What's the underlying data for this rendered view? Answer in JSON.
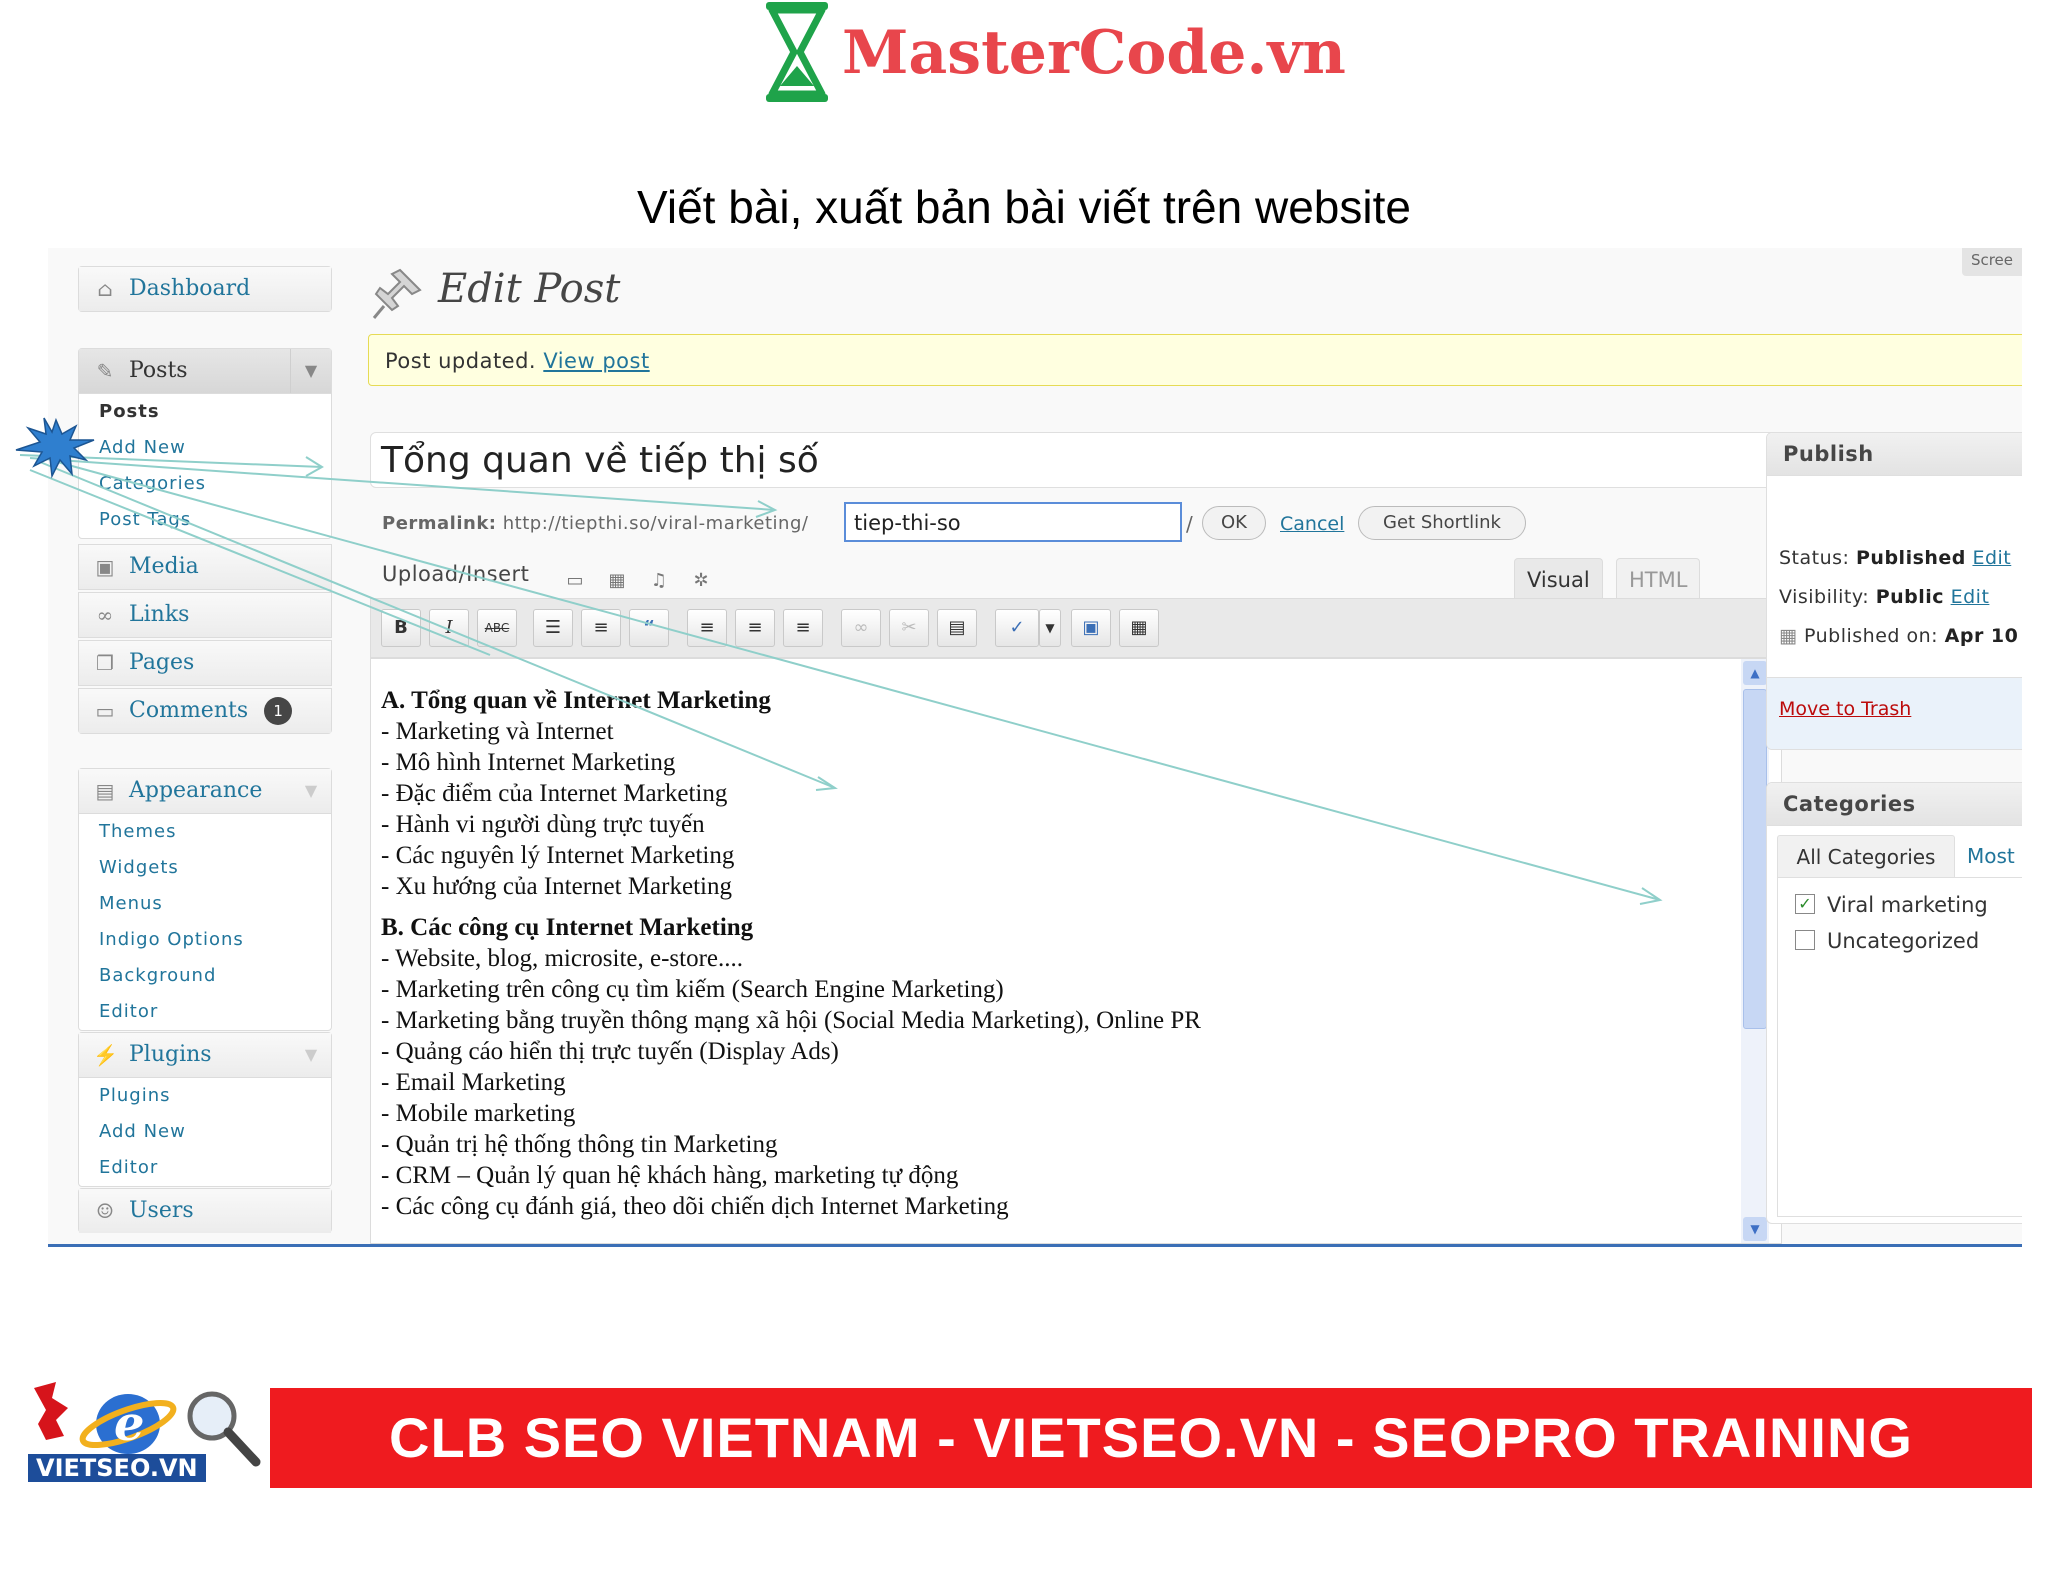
{
  "header": {
    "brand": "MasterCode.vn",
    "slide_title": "Viết bài, xuất bản bài viết trên website"
  },
  "sidebar": {
    "dashboard": "Dashboard",
    "posts": {
      "label": "Posts",
      "items": [
        "Posts",
        "Add New",
        "Categories",
        "Post Tags"
      ]
    },
    "media": "Media",
    "links": "Links",
    "pages": "Pages",
    "comments": {
      "label": "Comments",
      "count": "1"
    },
    "appearance": {
      "label": "Appearance",
      "items": [
        "Themes",
        "Widgets",
        "Menus",
        "Indigo Options",
        "Background",
        "Editor"
      ]
    },
    "plugins": {
      "label": "Plugins",
      "items": [
        "Plugins",
        "Add New",
        "Editor"
      ]
    },
    "users": "Users"
  },
  "main": {
    "page_title": "Edit Post",
    "screen_options": "Scree",
    "notice": {
      "text": "Post updated.",
      "link": "View post"
    },
    "post_title": "Tổng quan về tiếp thị số",
    "permalink": {
      "label": "Permalink:",
      "base": "http://tiepthi.so/viral-marketing/",
      "slug": "tiep-thi-so",
      "trailing": "/",
      "ok": "OK",
      "cancel": "Cancel",
      "shortlink": "Get Shortlink"
    },
    "upload_insert": "Upload/Insert",
    "tabs": {
      "visual": "Visual",
      "html": "HTML"
    },
    "toolbar": {
      "bold": "B",
      "italic": "I",
      "strike": "ABC"
    },
    "content": [
      {
        "text": "A. Tổng quan về Internet Marketing",
        "heading": true
      },
      {
        "text": "- Marketing và Internet"
      },
      {
        "text": "- Mô hình Internet Marketing"
      },
      {
        "text": "- Đặc điểm của Internet Marketing"
      },
      {
        "text": "- Hành vi người dùng trực tuyến"
      },
      {
        "text": "- Các nguyên lý Internet Marketing"
      },
      {
        "text": "- Xu hướng của Internet Marketing"
      },
      {
        "text": "B. Các công cụ Internet Marketing",
        "heading": true
      },
      {
        "text": "- Website, blog, microsite, e-store...."
      },
      {
        "text": "- Marketing trên công cụ tìm kiếm (Search Engine Marketing)"
      },
      {
        "text": "- Marketing bằng truyền thông mạng xã hội (Social Media Marketing), Online PR"
      },
      {
        "text": "- Quảng cáo hiển thị trực tuyến (Display Ads)"
      },
      {
        "text": "- Email Marketing"
      },
      {
        "text": "- Mobile marketing"
      },
      {
        "text": "- Quản trị hệ thống thông tin Marketing"
      },
      {
        "text": "- CRM – Quản lý quan hệ khách hàng, marketing tự động"
      },
      {
        "text": "- Các công cụ đánh giá, theo dõi chiến dịch Internet Marketing"
      }
    ]
  },
  "publish": {
    "title": "Publish",
    "status_label": "Status:",
    "status_value": "Published",
    "visibility_label": "Visibility:",
    "visibility_value": "Public",
    "edit": "Edit",
    "published_on_label": "Published on:",
    "published_on_value": "Apr 10",
    "trash": "Move to Trash"
  },
  "categories": {
    "title": "Categories",
    "tab_all": "All Categories",
    "tab_most": "Most",
    "items": [
      {
        "label": "Viral marketing",
        "checked": true
      },
      {
        "label": "Uncategorized",
        "checked": false
      }
    ]
  },
  "footer": {
    "logo_text": "VIETSEO.VN",
    "banner": "CLB SEO VIETNAM - VIETSEO.VN - SEOPRO TRAINING"
  },
  "colors": {
    "brand_red": "#e8464c",
    "wp_link": "#21759b",
    "notice_bg": "#ffffe0",
    "banner_red": "#ef1b1f"
  }
}
